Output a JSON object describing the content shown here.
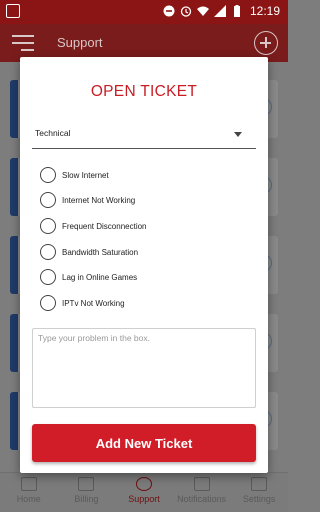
{
  "status_bar": {
    "time": "12:19",
    "icons": [
      "minus-circle-icon",
      "alarm-icon",
      "wifi-icon",
      "signal-icon",
      "battery-icon"
    ]
  },
  "app_bar": {
    "title": "Support",
    "menu_icon": "hamburger-menu-icon",
    "add_icon": "add-circle-icon"
  },
  "dialog": {
    "title": "OPEN TICKET",
    "category": {
      "selected": "Technical"
    },
    "options": [
      {
        "label": "Slow Internet"
      },
      {
        "label": "Internet Not Working"
      },
      {
        "label": "Frequent Disconnection"
      },
      {
        "label": "Bandwidth Saturation"
      },
      {
        "label": "Lag in Online Games"
      },
      {
        "label": "IPTv Not Working"
      }
    ],
    "problem": {
      "placeholder": "Type your problem in the box.",
      "value": ""
    },
    "submit_label": "Add New Ticket"
  },
  "bottom_nav": {
    "items": [
      {
        "label": "Home",
        "icon": "home-icon"
      },
      {
        "label": "Billing",
        "icon": "billing-icon"
      },
      {
        "label": "Support",
        "icon": "headset-icon",
        "active": true
      },
      {
        "label": "Notifications",
        "icon": "bell-icon"
      },
      {
        "label": "Settings",
        "icon": "gear-icon"
      }
    ]
  },
  "colors": {
    "accent": "#d11d28",
    "title": "#c81d25",
    "status_bar": "#8b1414"
  }
}
